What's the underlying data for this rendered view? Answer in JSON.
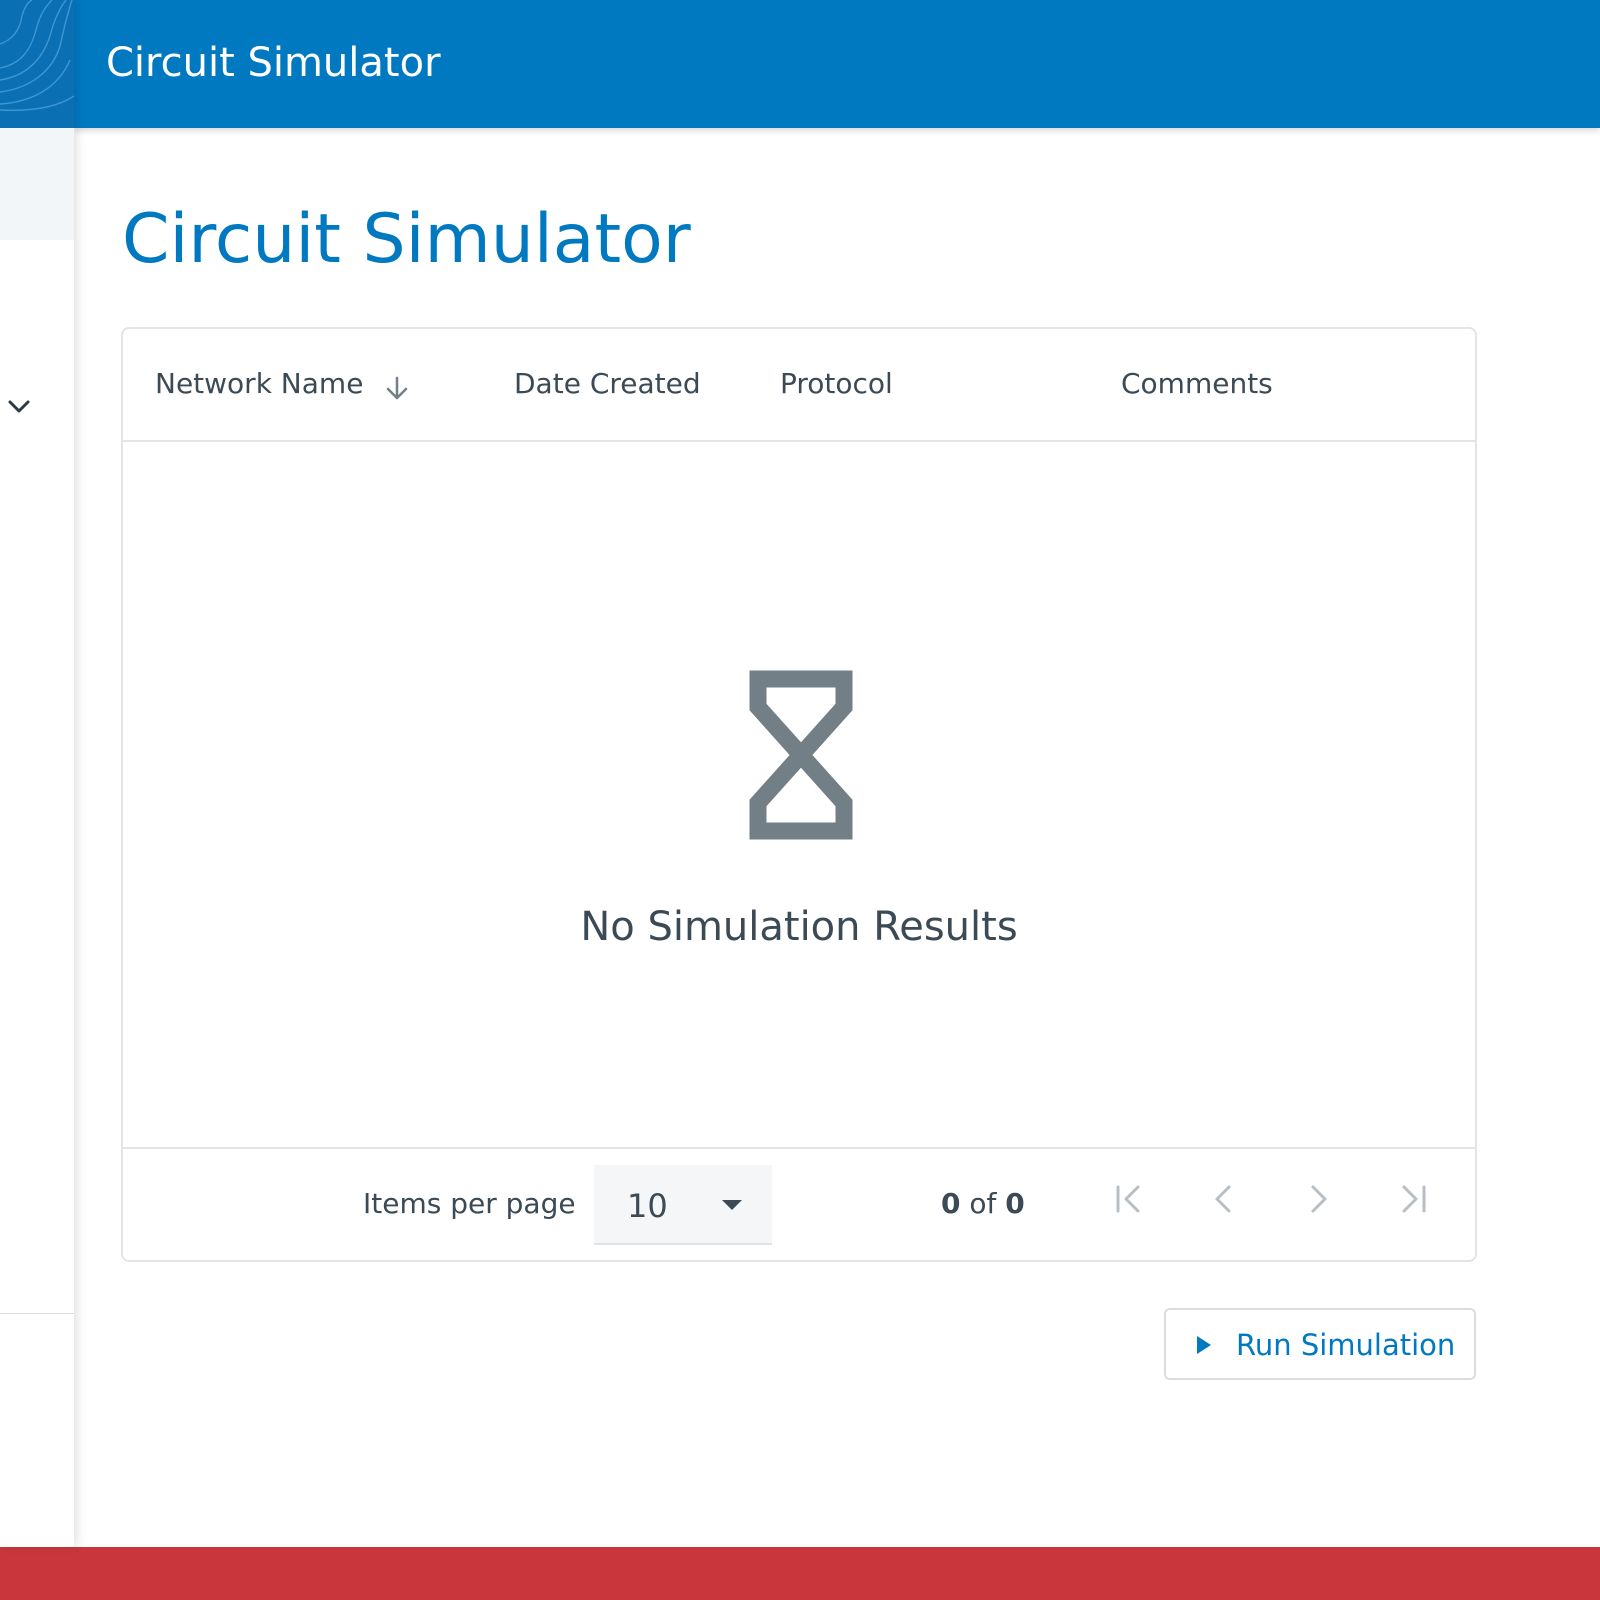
{
  "header": {
    "app_title": "Circuit Simulator"
  },
  "main": {
    "page_title": "Circuit Simulator"
  },
  "table": {
    "columns": [
      "Network Name",
      "Date Created",
      "Protocol",
      "Comments"
    ],
    "sort": {
      "column": "Network Name",
      "direction": "descending",
      "icon": "arrow-down-icon"
    },
    "empty_message": "No Simulation Results",
    "empty_icon": "hourglass-icon"
  },
  "pagination": {
    "items_per_page_label": "Items per page",
    "items_per_page_value": "10",
    "range_start": "0",
    "range_of": "of",
    "range_total": "0",
    "buttons": [
      "first-page-icon",
      "previous-page-icon",
      "next-page-icon",
      "last-page-icon"
    ]
  },
  "actions": {
    "run_label": "Run Simulation",
    "run_icon": "play-icon"
  },
  "colors": {
    "header_bg": "#0079c1",
    "accent": "#0079c1",
    "text": "#3b4a54",
    "footer_bar": "#c9373d",
    "muted_icon": "#737f86"
  }
}
